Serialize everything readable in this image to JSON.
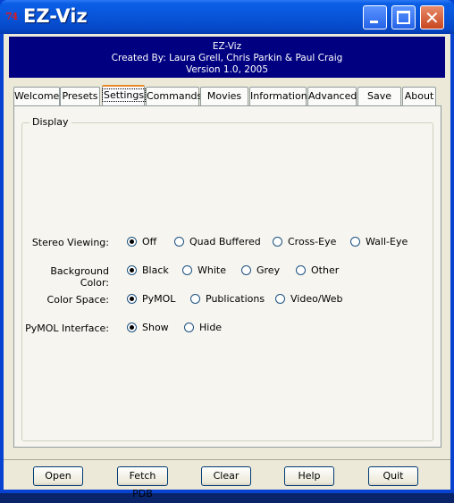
{
  "window": {
    "title": "EZ-Viz",
    "icon": "app-logo-icon"
  },
  "banner": {
    "line1": "EZ-Viz",
    "line2": "Created By: Laura Grell, Chris Parkin & Paul Craig",
    "line3": "Version 1.0, 2005"
  },
  "tabs": [
    "Welcome",
    "Presets",
    "Settings",
    "Commands",
    "Movies",
    "Information",
    "Advanced",
    "Save",
    "About"
  ],
  "active_tab": "Settings",
  "display_group": {
    "label": "Display",
    "rows": [
      {
        "label": "Stereo Viewing:",
        "options": [
          "Off",
          "Quad Buffered",
          "Cross-Eye",
          "Wall-Eye"
        ],
        "selected": "Off"
      },
      {
        "label": "Background Color:",
        "options": [
          "Black",
          "White",
          "Grey",
          "Other"
        ],
        "selected": "Black"
      },
      {
        "label": "Color Space:",
        "options": [
          "PyMOL",
          "Publications",
          "Video/Web"
        ],
        "selected": "PyMOL"
      },
      {
        "label": "PyMOL Interface:",
        "options": [
          "Show",
          "Hide"
        ],
        "selected": "Show"
      }
    ]
  },
  "buttons": [
    "Open",
    "Fetch PDB",
    "Clear",
    "Help",
    "Quit"
  ]
}
